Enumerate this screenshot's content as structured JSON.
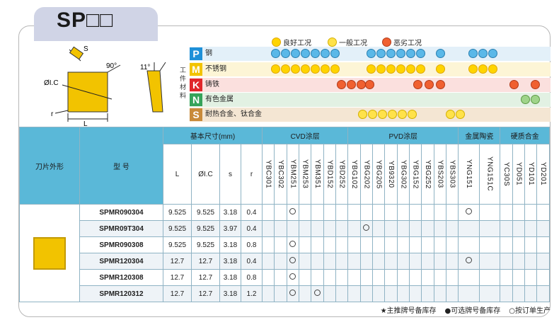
{
  "title": "SP□□",
  "legend": {
    "good": "良好工况",
    "normal": "一般工况",
    "bad": "恶劣工况"
  },
  "workpiece_label": "工件材料",
  "materials": [
    {
      "code": "P",
      "name": "钢",
      "color": "#1e90d8"
    },
    {
      "code": "M",
      "name": "不锈钢",
      "color": "#f2c300"
    },
    {
      "code": "K",
      "name": "铸铁",
      "color": "#e0262a"
    },
    {
      "code": "N",
      "name": "有色金属",
      "color": "#35a35a"
    },
    {
      "code": "S",
      "name": "耐热合金、钛合金",
      "color": "#c88a3a"
    }
  ],
  "diagram": {
    "ic_label": "ØI.C",
    "l_label": "L",
    "r_label": "r",
    "s_label": "S",
    "angle1": "90°",
    "angle2": "11°"
  },
  "table": {
    "col_shape": "刀片外形",
    "col_model": "型 号",
    "col_dims": "基本尺寸(mm)",
    "dim_headers": [
      "L",
      "ØI.C",
      "s",
      "r"
    ],
    "groups": [
      "CVD涂层",
      "PVD涂层",
      "金属陶瓷",
      "硬质合金"
    ],
    "grades": [
      "YBC301",
      "YBC302",
      "YBM251",
      "YBM253",
      "YBM351",
      "YBD152",
      "YBD252",
      "YBG102",
      "YBG202",
      "YBG205",
      "YB9320",
      "YBG302",
      "YBG152",
      "YBG252",
      "YBS203",
      "YBS303",
      "YNG151",
      "YNG151C",
      "YC30S",
      "YD051",
      "YD101",
      "YD201"
    ],
    "rows": [
      {
        "model": "SPMR090304",
        "L": "9.525",
        "IC": "9.525",
        "s": "3.18",
        "r": "0.4"
      },
      {
        "model": "SPMR09T304",
        "L": "9.525",
        "IC": "9.525",
        "s": "3.97",
        "r": "0.4"
      },
      {
        "model": "SPMR090308",
        "L": "9.525",
        "IC": "9.525",
        "s": "3.18",
        "r": "0.8"
      },
      {
        "model": "SPMR120304",
        "L": "12.7",
        "IC": "12.7",
        "s": "3.18",
        "r": "0.4"
      },
      {
        "model": "SPMR120308",
        "L": "12.7",
        "IC": "12.7",
        "s": "3.18",
        "r": "0.8"
      },
      {
        "model": "SPMR120312",
        "L": "12.7",
        "IC": "12.7",
        "s": "3.18",
        "r": "1.2"
      }
    ]
  },
  "footer": {
    "star": "★主推牌号备库存",
    "dot": "●可选牌号备库存",
    "circle": "○按订单生产"
  }
}
